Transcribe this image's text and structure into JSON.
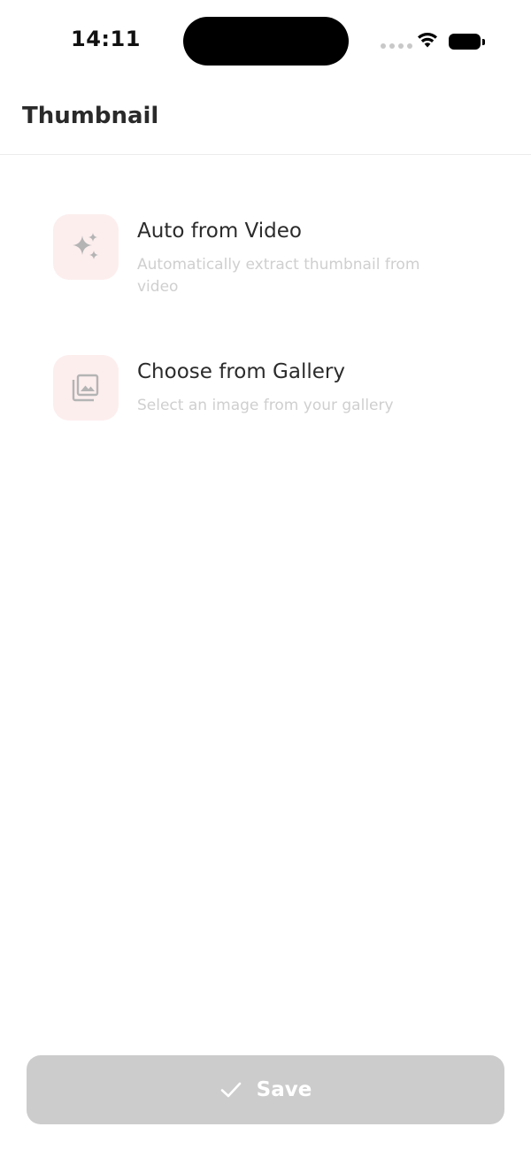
{
  "status_bar": {
    "time": "14:11",
    "icons": [
      "cellular-signal-icon",
      "wifi-icon",
      "battery-icon"
    ]
  },
  "header": {
    "title": "Thumbnail"
  },
  "options": [
    {
      "title": "Auto from Video",
      "description": "Automatically extract thumbnail from video",
      "icon": "sparkle-icon"
    },
    {
      "title": "Choose from Gallery",
      "description": "Select an image from your gallery",
      "icon": "gallery-icon"
    }
  ],
  "footer": {
    "save_label": "Save",
    "save_icon": "check-icon"
  },
  "colors": {
    "icon_tile_background": "#fdeeee",
    "button_disabled": "#cccccc",
    "description_text": "#cfcfcf"
  }
}
